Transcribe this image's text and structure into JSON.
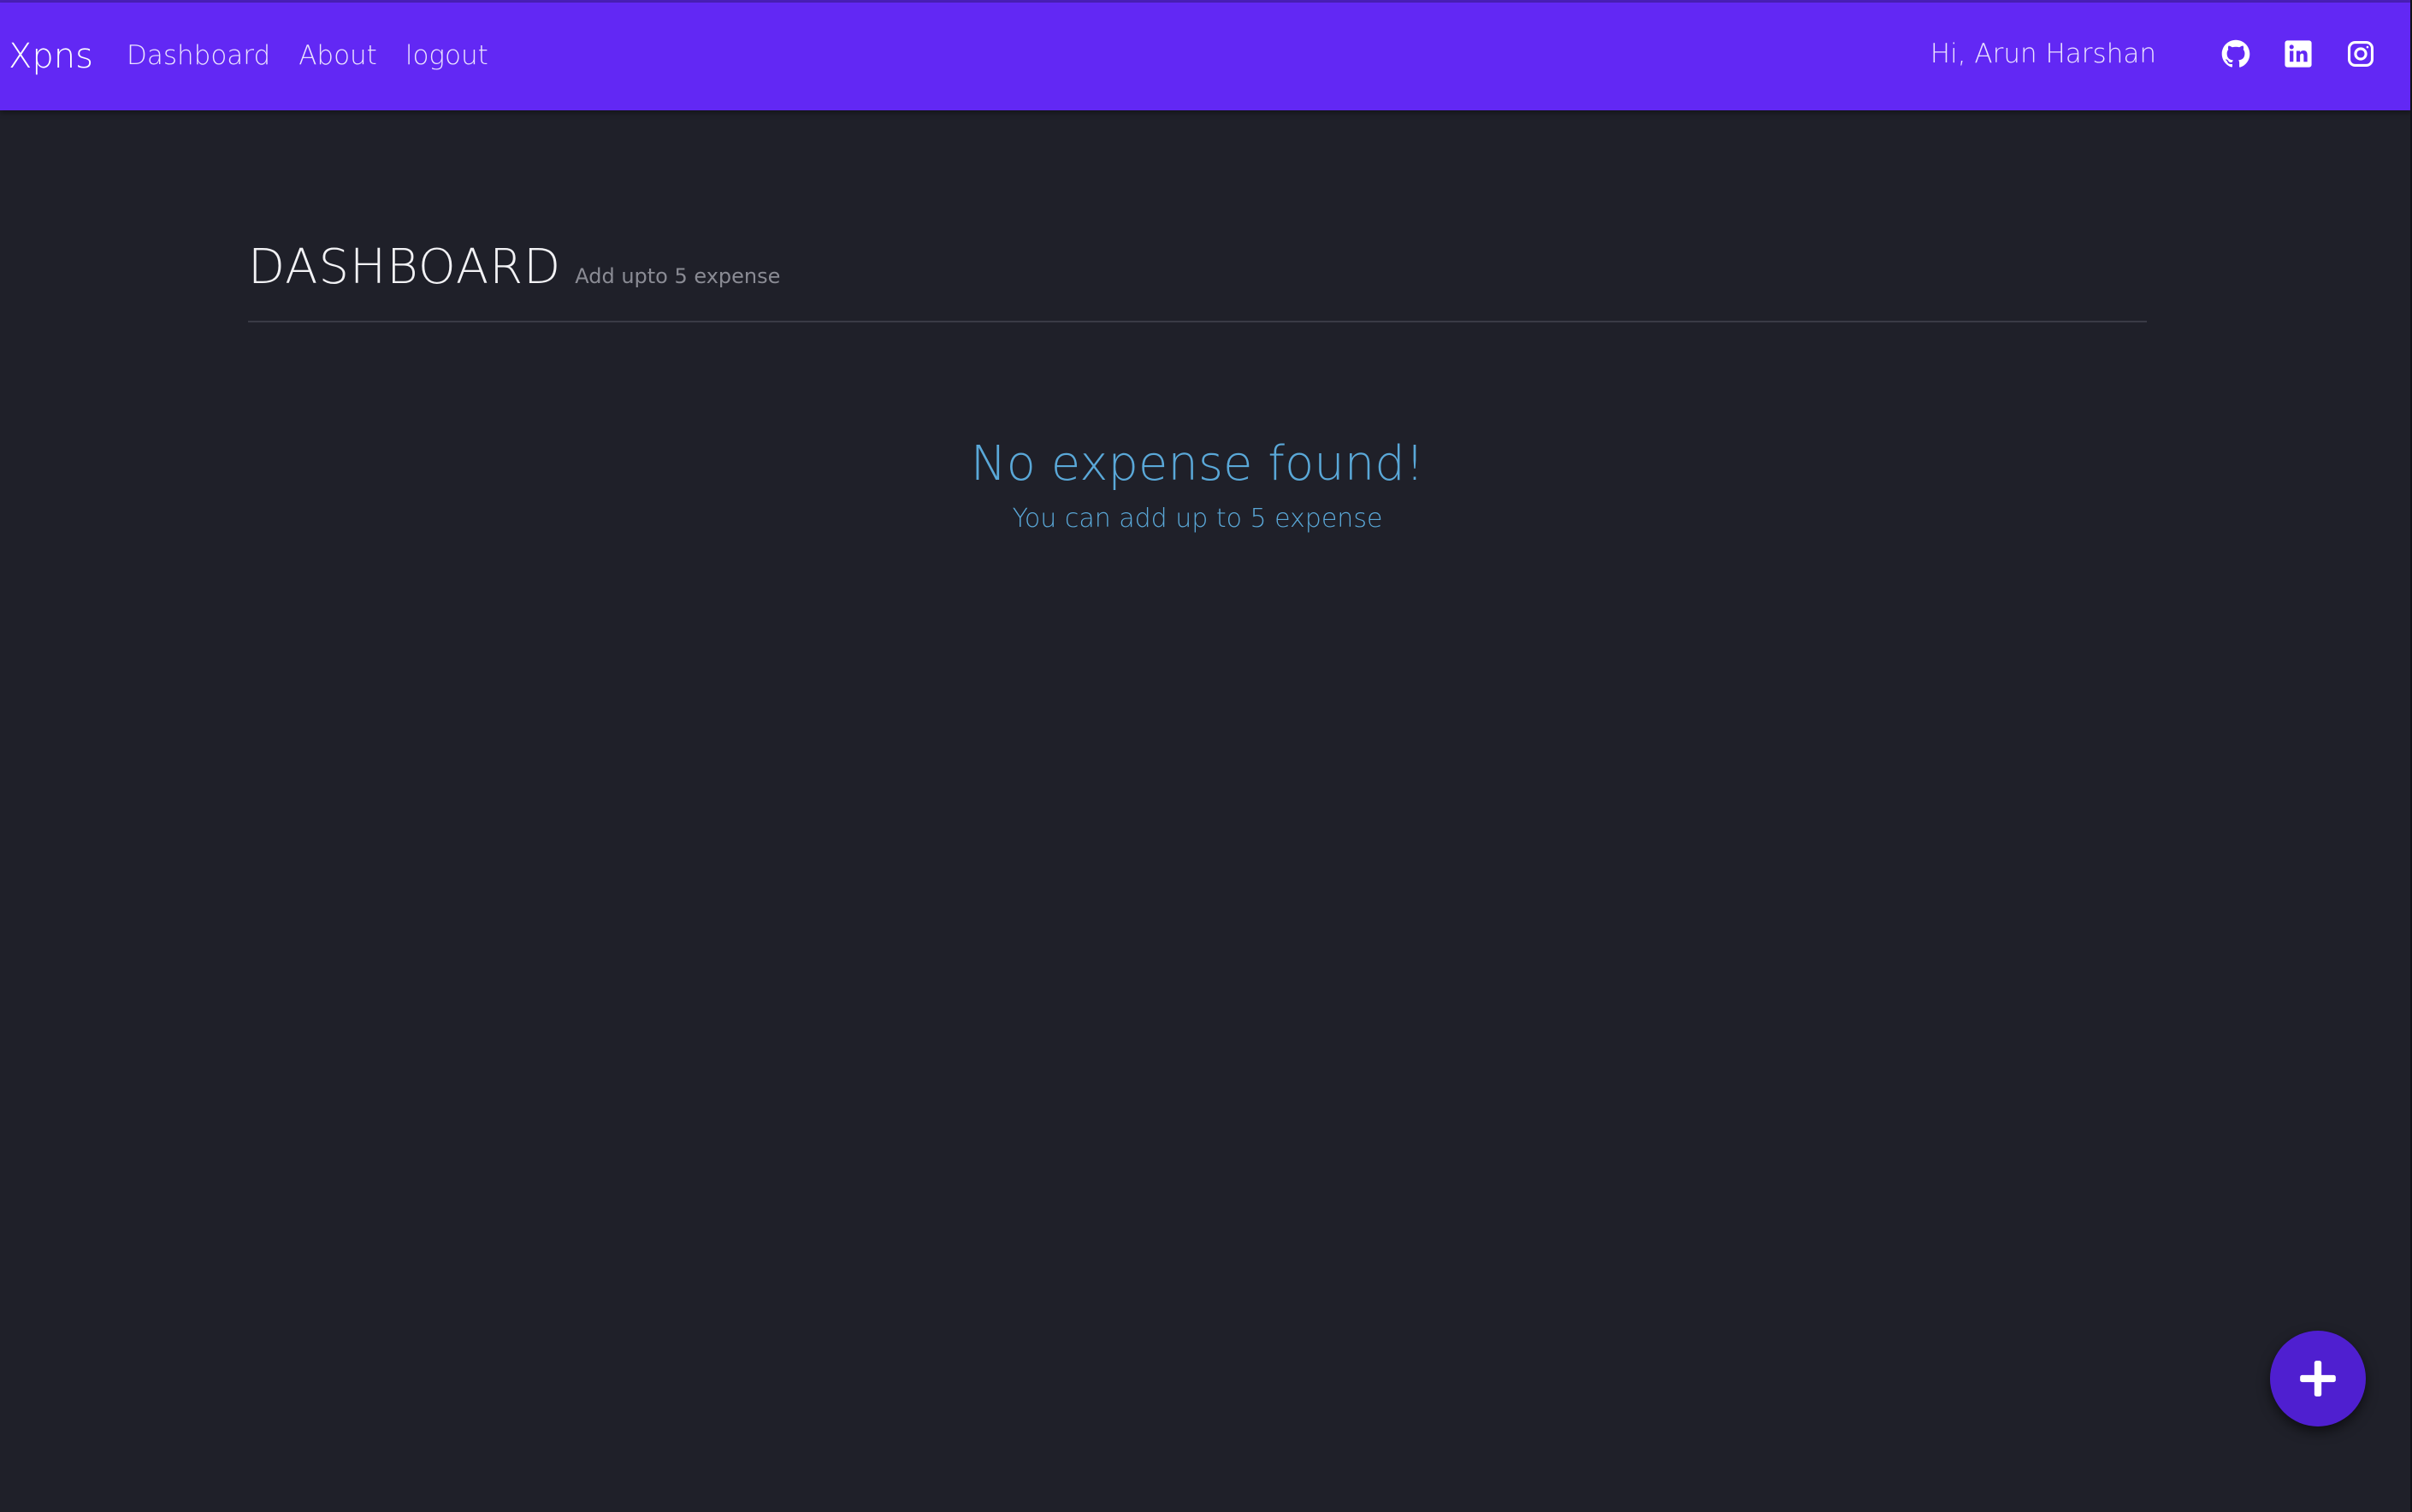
{
  "navbar": {
    "brand": "Xpns",
    "links": [
      "Dashboard",
      "About",
      "logout"
    ],
    "greeting": "Hi, Arun Harshan",
    "social_icons": [
      "github-icon",
      "linkedin-icon",
      "instagram-icon"
    ],
    "background_color": "#6228f4"
  },
  "page": {
    "title": "DASHBOARD",
    "subtitle": "Add upto 5 expense"
  },
  "empty_state": {
    "title": "No expense found!",
    "message": "You can add up to 5 expense",
    "color": "#5aa8d8"
  },
  "fab": {
    "icon": "plus-icon",
    "color": "#4f1fd0"
  },
  "theme": {
    "background": "#1f2029"
  }
}
